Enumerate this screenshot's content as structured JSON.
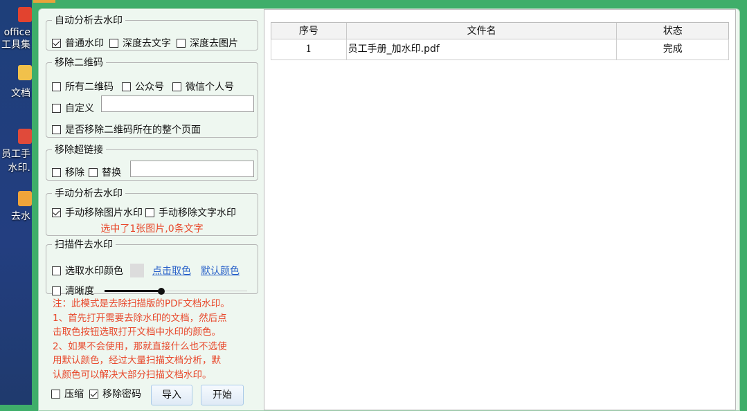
{
  "desktop": {
    "icons": [
      {
        "name": "office-tools",
        "label1": "office",
        "label2": "工具集",
        "color": "#e2432f"
      },
      {
        "name": "docs",
        "label1": "文档",
        "label2": "",
        "color": "#f1c14b"
      },
      {
        "name": "employee-pdf",
        "label1": "员工手",
        "label2": "水印.",
        "color": "#e04a3a"
      },
      {
        "name": "remove-watermark",
        "label1": "去水",
        "label2": "",
        "color": "#f0a43a"
      }
    ]
  },
  "auto": {
    "legend": "自动分析去水印",
    "normal": "普通水印",
    "deep_text": "深度去文字",
    "deep_image": "深度去图片"
  },
  "qr": {
    "legend": "移除二维码",
    "all": "所有二维码",
    "official": "公众号",
    "wechat": "微信个人号",
    "custom": "自定义",
    "custom_value": "",
    "whole_page": "是否移除二维码所在的整个页面"
  },
  "link": {
    "legend": "移除超链接",
    "remove": "移除",
    "replace": "替换",
    "replace_value": ""
  },
  "manual": {
    "legend": "手动分析去水印",
    "image": "手动移除图片水印",
    "text": "手动移除文字水印",
    "status": "选中了1张图片,0条文字"
  },
  "scan": {
    "legend": "扫描件去水印",
    "pick_color": "选取水印颜色",
    "click_pick": "点击取色",
    "default_color": "默认颜色",
    "clarity": "清晰度",
    "clarity_level": 0.4
  },
  "note": {
    "l1": "注：此模式是去除扫描版的PDF文档水印。",
    "l2": "1、首先打开需要去除水印的文档，然后点",
    "l3": "击取色按钮选取打开文档中水印的颜色。",
    "l4": "2、如果不会使用，那就直接什么也不选使",
    "l5": "用默认颜色，经过大量扫描文档分析，默",
    "l6": "认颜色可以解决大部分扫描文档水印。"
  },
  "bottom": {
    "compress": "压缩",
    "remove_password": "移除密码",
    "import": "导入",
    "start": "开始"
  },
  "table": {
    "headers": {
      "index": "序号",
      "filename": "文件名",
      "status": "状态"
    },
    "rows": [
      {
        "index": "1",
        "filename": "员工手册_加水印.pdf",
        "status": "完成"
      }
    ]
  }
}
